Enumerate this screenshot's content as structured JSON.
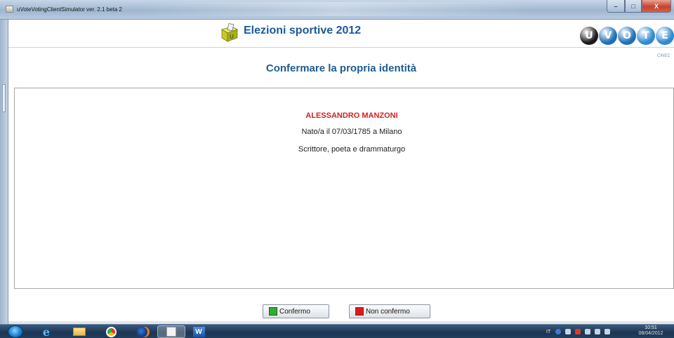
{
  "window": {
    "title": "uVoteVotingClientSimulator ver. 2.1 beta 2",
    "controls": {
      "minimize": "–",
      "maximize": "□",
      "close": "X"
    }
  },
  "header": {
    "title": "Elezioni sportive 2012",
    "logo_icon": "voting-box-icon",
    "brand_letters": [
      "U",
      "V",
      "O",
      "T",
      "E"
    ],
    "brand_colors": [
      "#1b1b1b",
      "#1f6fb8",
      "#1f6fb8",
      "#2e8ad0",
      "#2e8ad0"
    ],
    "brand_sub": "CINEC"
  },
  "heading": "Confermare la propria identità",
  "identity": {
    "name": "ALESSANDRO MANZONI",
    "birth": "Nato/a il 07/03/1785 a Milano",
    "description": "Scrittore, poeta e drammaturgo"
  },
  "actions": {
    "confirm_label": "Confermo",
    "deny_label": "Non confermo",
    "confirm_color": "#2db02d",
    "deny_color": "#e01818"
  },
  "taskbar": {
    "items": [
      "start-orb-icon",
      "internet-explorer-icon",
      "folder-icon",
      "chrome-icon",
      "firefox-icon",
      "java-app-icon",
      "word-icon"
    ],
    "ie_glyph": "e",
    "word_glyph": "W",
    "tray": {
      "lang": "IT"
    },
    "clock": {
      "time": "10:51",
      "date": "08/04/2012"
    }
  }
}
